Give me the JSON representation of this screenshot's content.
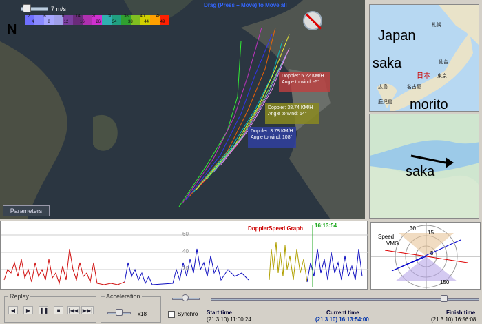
{
  "map": {
    "wind_label": "7 m/s",
    "drag_hint": "Drag (Press + Move) to Move all",
    "north_arrow": "N",
    "scale_colors": [
      "#6f6fff",
      "#8a8aff",
      "#a7a7ff",
      "#9f9fe8",
      "#7b3f9f",
      "#6a2b7a",
      "#b030b0",
      "#d030d0",
      "#30b0b0",
      "#20a080",
      "#30a030",
      "#80c020",
      "#d0d000",
      "#ffa000",
      "#ff2000"
    ],
    "scale_ticks_top": [
      "2",
      "6",
      "10",
      "14",
      "20",
      "30",
      "36",
      "40",
      "46"
    ],
    "scale_ticks_bottom": [
      "4",
      "8",
      "12",
      "16",
      "26",
      "34",
      "38",
      "44",
      "49"
    ],
    "info_boxes": [
      {
        "text": "Doppler: 5.22 KM/H\nAngle to wind: -5°",
        "color": "#c04040"
      },
      {
        "text": "Doppler: 38.74 KM/H\nAngle to wind: 64°",
        "color": "#8a8a20"
      },
      {
        "text": "Doppler: 3.78 KM/H\nAngle to wind: 108°",
        "color": "#3040a0"
      }
    ],
    "params_button": "Parameters"
  },
  "japan": {
    "labels": [
      "Japan",
      "saka",
      "morito",
      "saka"
    ],
    "small": [
      "札幌",
      "仙台",
      "東京",
      "名古屋",
      "広島",
      "鹿児島",
      "日本"
    ]
  },
  "graph": {
    "title": "DopplerSpeed Graph",
    "time_marker": "16:13:54",
    "y_ticks": [
      "60",
      "40",
      "20"
    ],
    "series": [
      {
        "name": "red",
        "color": "#d01010"
      },
      {
        "name": "blue",
        "color": "#1010c0"
      },
      {
        "name": "olive",
        "color": "#b0a000"
      }
    ]
  },
  "polar": {
    "legend": [
      "Speed",
      "VMG"
    ],
    "ticks": [
      "30",
      "25",
      "20",
      "15",
      "10",
      "5",
      "150"
    ]
  },
  "replay": {
    "title": "Replay",
    "buttons": [
      "◀",
      "▶",
      "❚❚",
      "■",
      "|◀◀",
      "▶▶|"
    ]
  },
  "acceleration": {
    "title": "Acceleration",
    "value": "x18"
  },
  "synchro": {
    "label": "Synchro"
  },
  "times": {
    "start_label": "Start time",
    "start_value": "(21 3 10) 11:00:24",
    "current_label": "Current time",
    "current_value": "(21 3 10) 16:13:54:00",
    "finish_label": "Finish time",
    "finish_value": "(21 3 10) 16:56:08"
  }
}
